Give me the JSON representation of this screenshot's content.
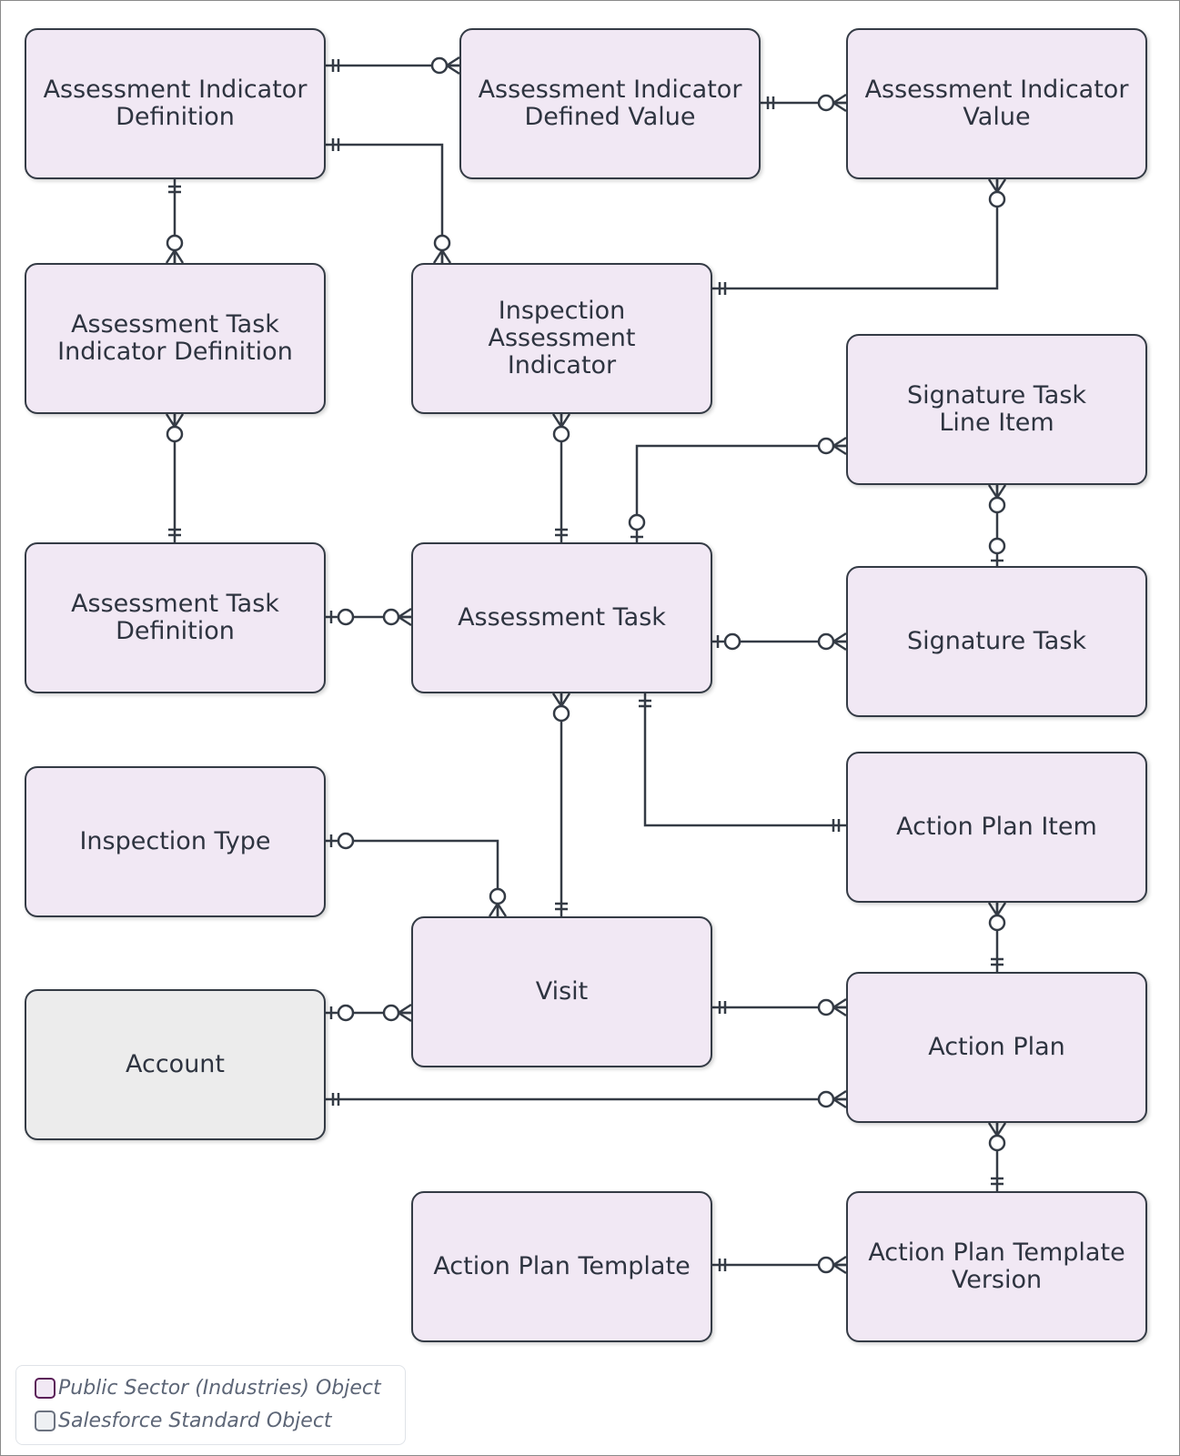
{
  "entities": {
    "aid": {
      "label": "Assessment Indicator Definition",
      "type": "industries"
    },
    "aidv": {
      "label": "Assessment Indicator Defined Value",
      "type": "industries"
    },
    "aiv": {
      "label": "Assessment Indicator Value",
      "type": "industries"
    },
    "atid": {
      "label": "Assessment Task Indicator Definition",
      "type": "industries"
    },
    "iai": {
      "label": "Inspection Assessment Indicator",
      "type": "industries"
    },
    "stli": {
      "label": "Signature Task Line Item",
      "type": "industries"
    },
    "atd": {
      "label": "Assessment Task Definition",
      "type": "industries"
    },
    "at": {
      "label": "Assessment Task",
      "type": "industries"
    },
    "st": {
      "label": "Signature Task",
      "type": "industries"
    },
    "it": {
      "label": "Inspection Type",
      "type": "industries"
    },
    "api": {
      "label": "Action Plan Item",
      "type": "industries"
    },
    "visit": {
      "label": "Visit",
      "type": "industries"
    },
    "ap": {
      "label": "Action Plan",
      "type": "industries"
    },
    "account": {
      "label": "Account",
      "type": "standard"
    },
    "apt": {
      "label": "Action Plan Template",
      "type": "industries"
    },
    "aptv": {
      "label": "Action Plan Template Version",
      "type": "industries"
    }
  },
  "relationships": [
    {
      "from": "aid",
      "to": "aidv",
      "from_card": "one-and-only-one",
      "to_card": "zero-or-many"
    },
    {
      "from": "aidv",
      "to": "aiv",
      "from_card": "one-and-only-one",
      "to_card": "zero-or-many"
    },
    {
      "from": "aid",
      "to": "iai",
      "from_card": "one-and-only-one",
      "to_card": "zero-or-many"
    },
    {
      "from": "aid",
      "to": "atid",
      "from_card": "one-and-only-one",
      "to_card": "zero-or-many"
    },
    {
      "from": "iai",
      "to": "aiv",
      "from_card": "one-and-only-one",
      "to_card": "zero-or-many"
    },
    {
      "from": "at",
      "to": "atid",
      "from_card": "one-and-only-one",
      "to_card": "zero-or-many"
    },
    {
      "from": "at",
      "to": "iai",
      "from_card": "one-and-only-one",
      "to_card": "zero-or-many"
    },
    {
      "from": "at",
      "to": "stli",
      "from_card": "zero-or-one",
      "to_card": "zero-or-many"
    },
    {
      "from": "st",
      "to": "stli",
      "from_card": "zero-or-one",
      "to_card": "zero-or-many"
    },
    {
      "from": "atd",
      "to": "at",
      "from_card": "zero-or-one",
      "to_card": "zero-or-many"
    },
    {
      "from": "at",
      "to": "st",
      "from_card": "zero-or-one",
      "to_card": "zero-or-many"
    },
    {
      "from": "visit",
      "to": "at",
      "from_card": "one-and-only-one",
      "to_card": "zero-or-many"
    },
    {
      "from": "at",
      "to": "api",
      "from_card": "one-and-only-one",
      "to_card": "one-and-only-one"
    },
    {
      "from": "it",
      "to": "visit",
      "from_card": "zero-or-one",
      "to_card": "zero-or-many"
    },
    {
      "from": "ap",
      "to": "api",
      "from_card": "one-and-only-one",
      "to_card": "zero-or-many"
    },
    {
      "from": "account",
      "to": "visit",
      "from_card": "zero-or-one",
      "to_card": "zero-or-many"
    },
    {
      "from": "visit",
      "to": "ap",
      "from_card": "one-and-only-one",
      "to_card": "zero-or-many"
    },
    {
      "from": "account",
      "to": "ap",
      "from_card": "one-and-only-one",
      "to_card": "zero-or-many"
    },
    {
      "from": "aptv",
      "to": "ap",
      "from_card": "one-and-only-one",
      "to_card": "zero-or-many"
    },
    {
      "from": "apt",
      "to": "aptv",
      "from_card": "one-and-only-one",
      "to_card": "zero-or-many"
    }
  ],
  "legend": {
    "items": [
      {
        "label": "Public Sector (Industries) Object",
        "fill": "#f1e8f4",
        "stroke": "#5b1e58"
      },
      {
        "label": "Salesforce Standard Object",
        "fill": "#eef0f3",
        "stroke": "#6b7280"
      }
    ]
  },
  "colors": {
    "line": "#343b45",
    "industries_fill": "#f1e8f4",
    "standard_fill": "#ececec"
  }
}
